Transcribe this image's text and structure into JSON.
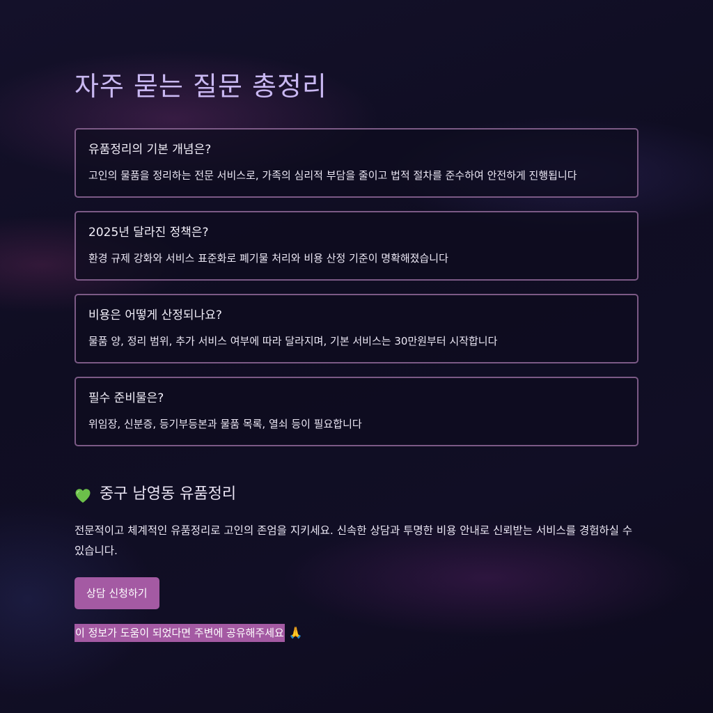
{
  "title": "자주 묻는 질문 총정리",
  "faq": [
    {
      "question": "유품정리의 기본 개념은?",
      "answer": "고인의 물품을 정리하는 전문 서비스로, 가족의 심리적 부담을 줄이고 법적 절차를 준수하여 안전하게 진행됩니다"
    },
    {
      "question": "2025년 달라진 정책은?",
      "answer": "환경 규제 강화와 서비스 표준화로 폐기물 처리와 비용 산정 기준이 명확해졌습니다"
    },
    {
      "question": "비용은 어떻게 산정되나요?",
      "answer": "물품 양, 정리 범위, 추가 서비스 여부에 따라 달라지며, 기본 서비스는 30만원부터 시작합니다"
    },
    {
      "question": "필수 준비물은?",
      "answer": "위임장, 신분증, 등기부등본과 물품 목록, 열쇠 등이 필요합니다"
    }
  ],
  "section": {
    "icon": "green-heart-icon",
    "heading": "중구 남영동 유품정리",
    "body": "전문적이고 체계적인 유품정리로 고인의 존엄을 지키세요. 신속한 상담과 투명한 비용 안내로 신뢰받는 서비스를 경험하실 수 있습니다.",
    "cta_label": "상담 신청하기",
    "share_text": "이 정보가 도움이 되었다면 주변에 공유해주세요",
    "share_icon": "🙏"
  },
  "colors": {
    "background": "#110e25",
    "title": "#c9b8f2",
    "card_border": "#7c5a86",
    "accent": "#a45aa3",
    "heart": "#6cc04a"
  }
}
